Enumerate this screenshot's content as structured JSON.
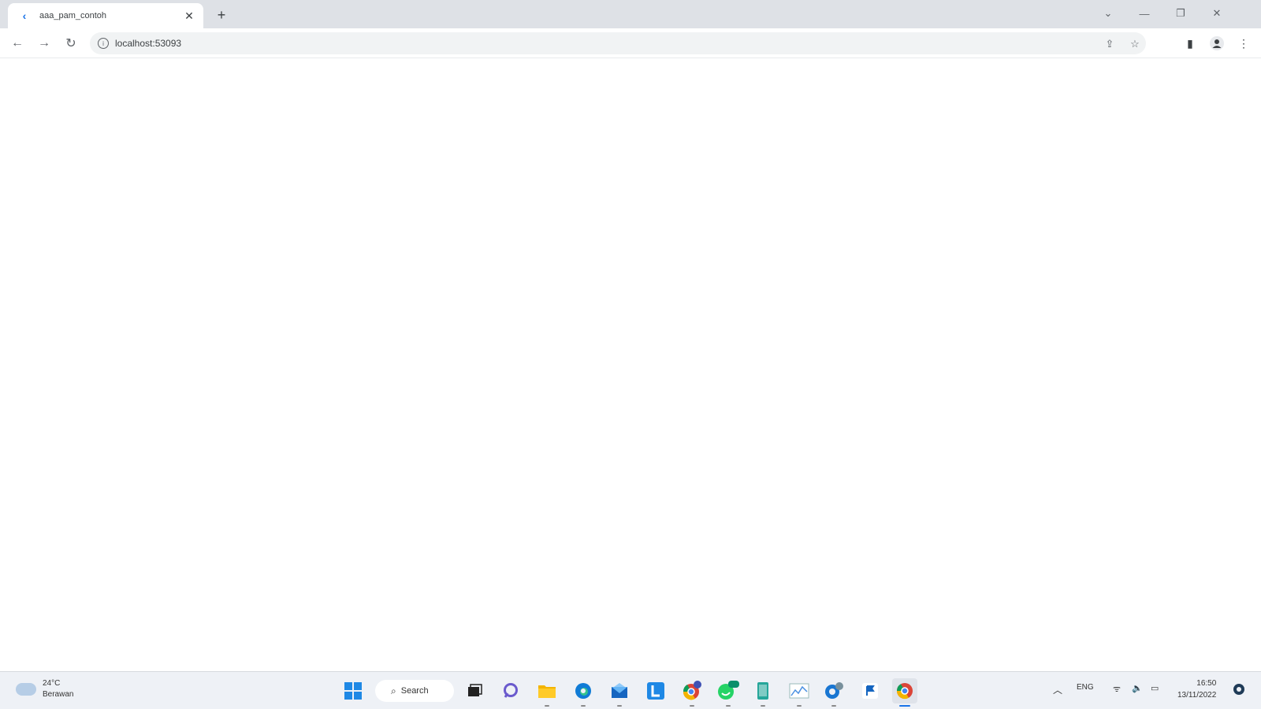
{
  "browser": {
    "tab_title": "aaa_pam_contoh",
    "url": "localhost:53093",
    "new_tab_symbol": "+",
    "close_symbol": "✕"
  },
  "taskbar": {
    "weather_temp": "24°C",
    "weather_desc": "Berawan",
    "search_label": "Search",
    "language": "ENG",
    "time": "16:50",
    "date": "13/11/2022"
  },
  "colors": {
    "tabstrip": "#dee1e6",
    "taskbar": "#eef1f6",
    "accent": "#1a73e8"
  }
}
